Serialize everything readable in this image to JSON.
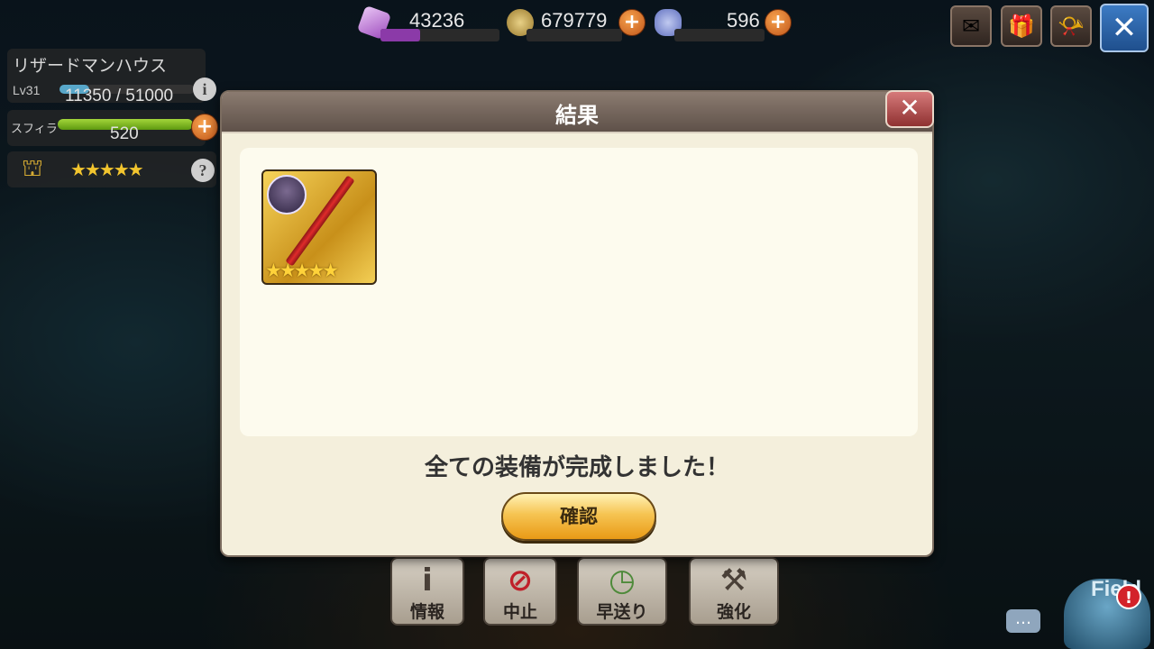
{
  "resources": [
    {
      "name": "crystal",
      "value": "43236",
      "color": "#8b3aa8",
      "level": 0.33,
      "icon": "crystal-icon"
    },
    {
      "name": "gil",
      "value": "679779",
      "color": "#c9a54a",
      "level": 0.0,
      "icon": "coin-icon"
    },
    {
      "name": "gem",
      "value": "596",
      "color": "#5a6cc4",
      "level": 0.0,
      "icon": "gem-icon"
    }
  ],
  "house": {
    "name": "リザードマンハウス",
    "level": "Lv31",
    "xp": "11350 / 51000",
    "xp_fraction": 0.22
  },
  "sphira": {
    "label": "スフィラ",
    "value": "520",
    "fraction": 1.0
  },
  "rank_stars": "★★★★★",
  "modal": {
    "title": "結果",
    "close_glyph": "✕",
    "item_stars": "★★★★★",
    "message": "全ての装備が完成しました！",
    "confirm_label": "確認"
  },
  "actions": [
    {
      "label": "情報",
      "icon": "info-icon"
    },
    {
      "label": "中止",
      "icon": "stop-icon"
    },
    {
      "label": "早送り",
      "icon": "fast-forward-icon"
    },
    {
      "label": "強化",
      "icon": "enhance-icon"
    }
  ],
  "field": {
    "label": "Field",
    "alert": "!"
  }
}
